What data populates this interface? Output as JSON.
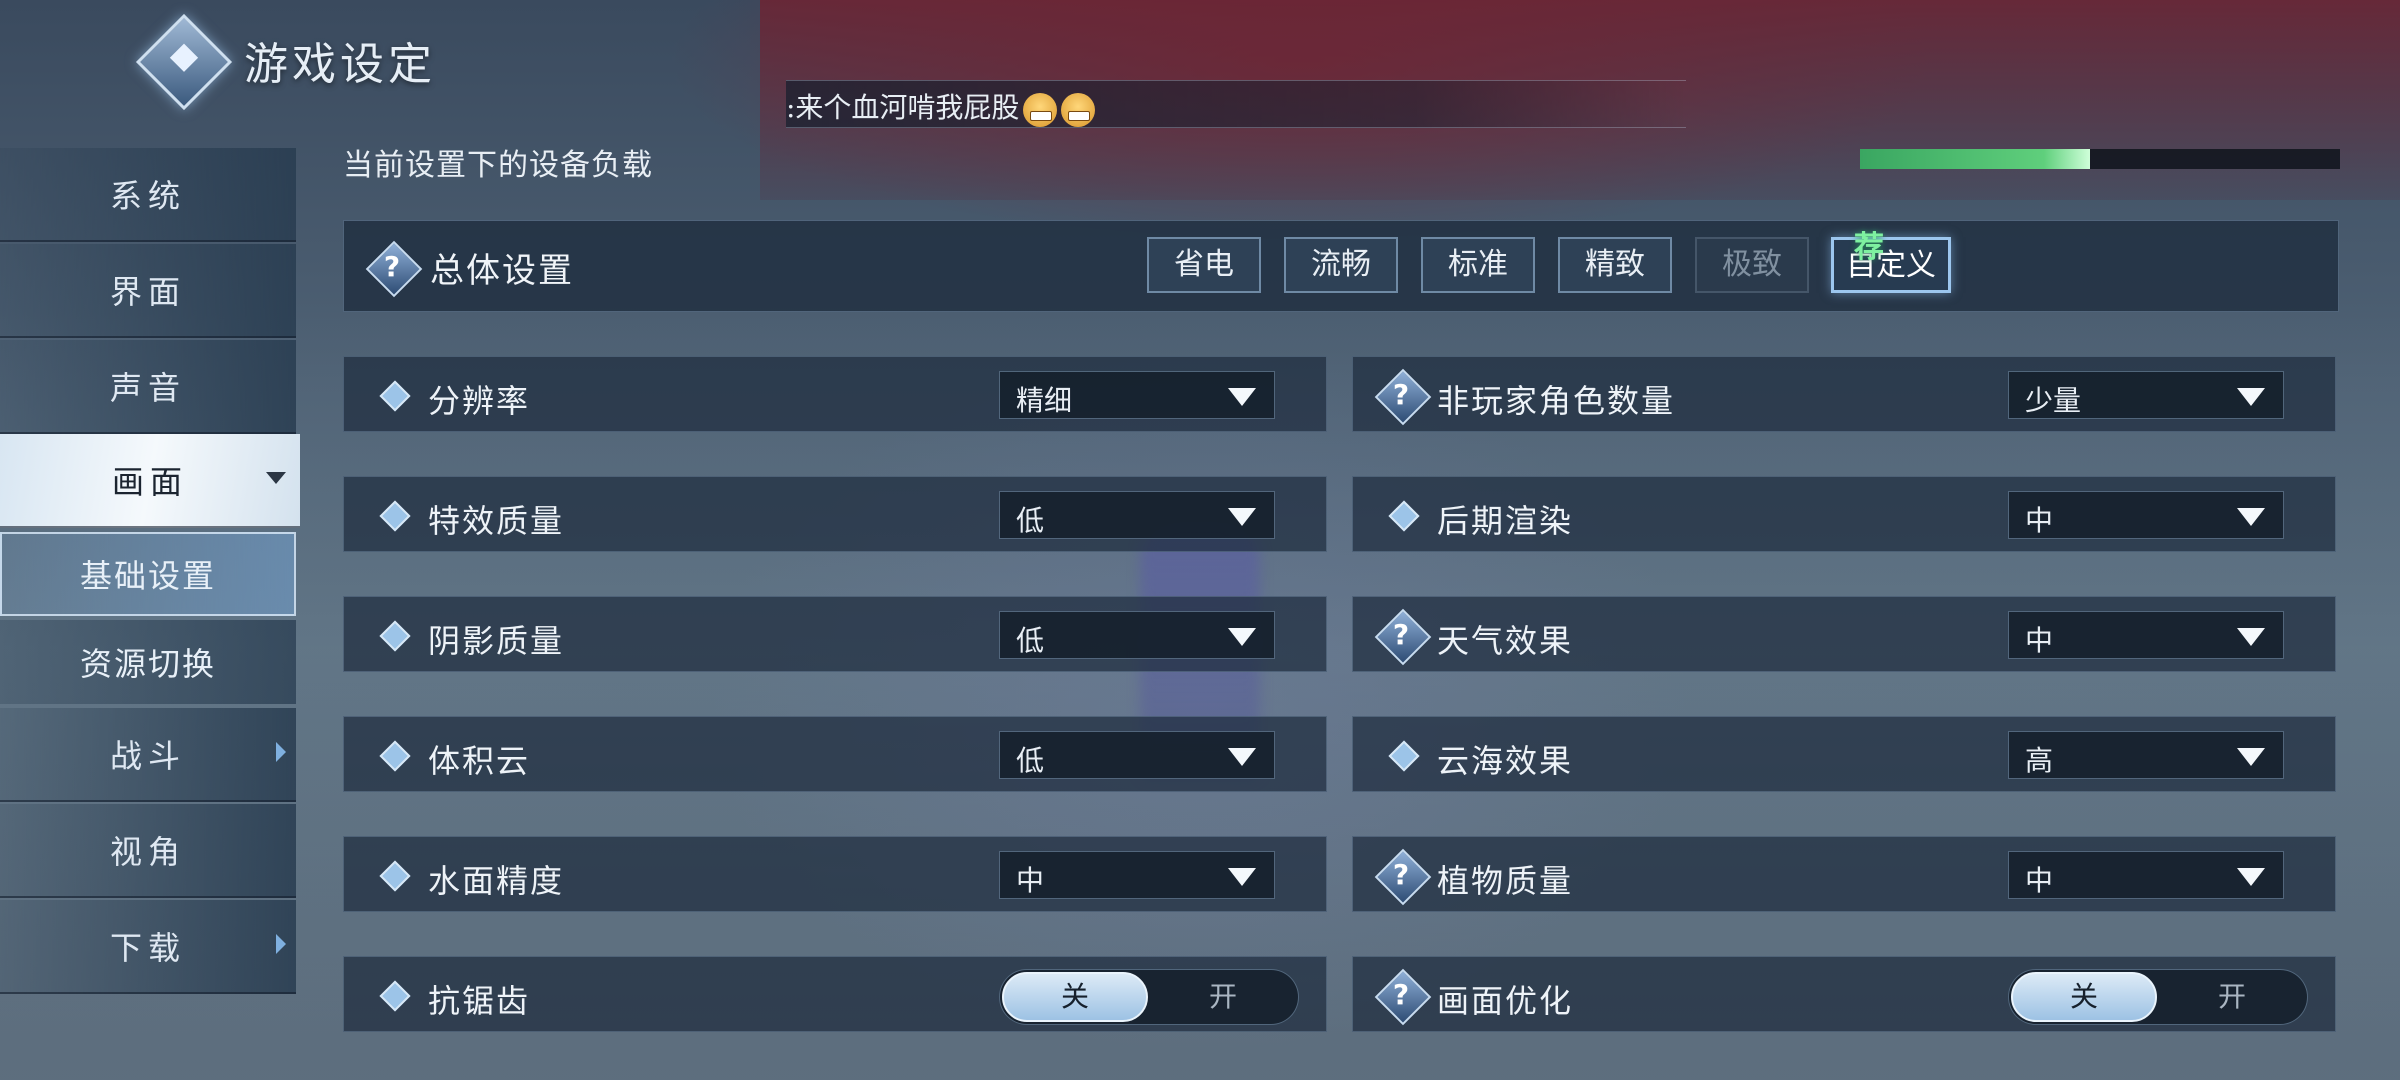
{
  "header": {
    "title": "游戏设定"
  },
  "chat": {
    "text": ":来个血河啃我屁股",
    "emoji_count": 2
  },
  "load": {
    "label": "当前设置下的设备负载",
    "fraction": 0.48,
    "color": "#4fbf6f"
  },
  "sidebar": {
    "items": [
      {
        "label": "系统"
      },
      {
        "label": "界面"
      },
      {
        "label": "声音"
      },
      {
        "label": "画面",
        "active": true
      },
      {
        "label": "基础设置",
        "sub": true,
        "selected": true
      },
      {
        "label": "资源切换",
        "sub": true
      },
      {
        "label": "战斗",
        "has_arrow": true
      },
      {
        "label": "视角"
      },
      {
        "label": "下载",
        "has_arrow": true
      }
    ]
  },
  "overall": {
    "title": "总体设置",
    "presets": [
      {
        "label": "省电"
      },
      {
        "label": "流畅"
      },
      {
        "label": "标准"
      },
      {
        "label": "精致"
      },
      {
        "label": "极致",
        "disabled": true
      },
      {
        "label": "自定义",
        "selected": true
      }
    ],
    "recommend_badge": "荐"
  },
  "settings_left": [
    {
      "label": "分辨率",
      "value": "精细",
      "icon": "diamond-icon"
    },
    {
      "label": "特效质量",
      "value": "低",
      "icon": "diamond-icon"
    },
    {
      "label": "阴影质量",
      "value": "低",
      "icon": "diamond-icon"
    },
    {
      "label": "体积云",
      "value": "低",
      "icon": "diamond-icon"
    },
    {
      "label": "水面精度",
      "value": "中",
      "icon": "diamond-icon"
    },
    {
      "label": "抗锯齿",
      "toggle": true,
      "on_label": "关",
      "off_label": "开",
      "icon": "diamond-icon"
    }
  ],
  "settings_right": [
    {
      "label": "非玩家角色数量",
      "value": "少量",
      "icon": "help-icon"
    },
    {
      "label": "后期渲染",
      "value": "中",
      "icon": "diamond-icon"
    },
    {
      "label": "天气效果",
      "value": "中",
      "icon": "help-icon"
    },
    {
      "label": "云海效果",
      "value": "高",
      "icon": "diamond-icon"
    },
    {
      "label": "植物质量",
      "value": "中",
      "icon": "help-icon"
    },
    {
      "label": "画面优化",
      "toggle": true,
      "on_label": "关",
      "off_label": "开",
      "icon": "help-icon"
    }
  ],
  "help_mark": "?"
}
